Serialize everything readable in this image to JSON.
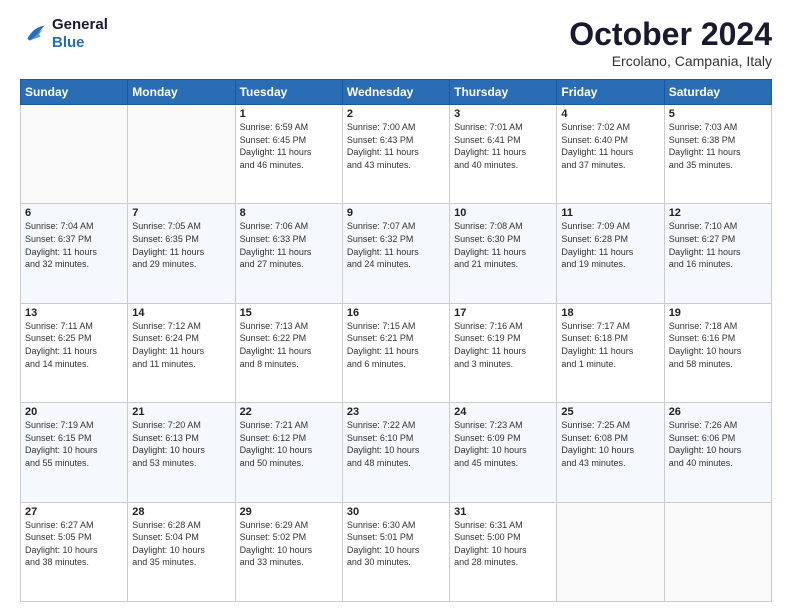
{
  "header": {
    "logo": {
      "line1": "General",
      "line2": "Blue"
    },
    "title": "October 2024",
    "location": "Ercolano, Campania, Italy"
  },
  "weekdays": [
    "Sunday",
    "Monday",
    "Tuesday",
    "Wednesday",
    "Thursday",
    "Friday",
    "Saturday"
  ],
  "weeks": [
    [
      {
        "day": "",
        "info": ""
      },
      {
        "day": "",
        "info": ""
      },
      {
        "day": "1",
        "info": "Sunrise: 6:59 AM\nSunset: 6:45 PM\nDaylight: 11 hours\nand 46 minutes."
      },
      {
        "day": "2",
        "info": "Sunrise: 7:00 AM\nSunset: 6:43 PM\nDaylight: 11 hours\nand 43 minutes."
      },
      {
        "day": "3",
        "info": "Sunrise: 7:01 AM\nSunset: 6:41 PM\nDaylight: 11 hours\nand 40 minutes."
      },
      {
        "day": "4",
        "info": "Sunrise: 7:02 AM\nSunset: 6:40 PM\nDaylight: 11 hours\nand 37 minutes."
      },
      {
        "day": "5",
        "info": "Sunrise: 7:03 AM\nSunset: 6:38 PM\nDaylight: 11 hours\nand 35 minutes."
      }
    ],
    [
      {
        "day": "6",
        "info": "Sunrise: 7:04 AM\nSunset: 6:37 PM\nDaylight: 11 hours\nand 32 minutes."
      },
      {
        "day": "7",
        "info": "Sunrise: 7:05 AM\nSunset: 6:35 PM\nDaylight: 11 hours\nand 29 minutes."
      },
      {
        "day": "8",
        "info": "Sunrise: 7:06 AM\nSunset: 6:33 PM\nDaylight: 11 hours\nand 27 minutes."
      },
      {
        "day": "9",
        "info": "Sunrise: 7:07 AM\nSunset: 6:32 PM\nDaylight: 11 hours\nand 24 minutes."
      },
      {
        "day": "10",
        "info": "Sunrise: 7:08 AM\nSunset: 6:30 PM\nDaylight: 11 hours\nand 21 minutes."
      },
      {
        "day": "11",
        "info": "Sunrise: 7:09 AM\nSunset: 6:28 PM\nDaylight: 11 hours\nand 19 minutes."
      },
      {
        "day": "12",
        "info": "Sunrise: 7:10 AM\nSunset: 6:27 PM\nDaylight: 11 hours\nand 16 minutes."
      }
    ],
    [
      {
        "day": "13",
        "info": "Sunrise: 7:11 AM\nSunset: 6:25 PM\nDaylight: 11 hours\nand 14 minutes."
      },
      {
        "day": "14",
        "info": "Sunrise: 7:12 AM\nSunset: 6:24 PM\nDaylight: 11 hours\nand 11 minutes."
      },
      {
        "day": "15",
        "info": "Sunrise: 7:13 AM\nSunset: 6:22 PM\nDaylight: 11 hours\nand 8 minutes."
      },
      {
        "day": "16",
        "info": "Sunrise: 7:15 AM\nSunset: 6:21 PM\nDaylight: 11 hours\nand 6 minutes."
      },
      {
        "day": "17",
        "info": "Sunrise: 7:16 AM\nSunset: 6:19 PM\nDaylight: 11 hours\nand 3 minutes."
      },
      {
        "day": "18",
        "info": "Sunrise: 7:17 AM\nSunset: 6:18 PM\nDaylight: 11 hours\nand 1 minute."
      },
      {
        "day": "19",
        "info": "Sunrise: 7:18 AM\nSunset: 6:16 PM\nDaylight: 10 hours\nand 58 minutes."
      }
    ],
    [
      {
        "day": "20",
        "info": "Sunrise: 7:19 AM\nSunset: 6:15 PM\nDaylight: 10 hours\nand 55 minutes."
      },
      {
        "day": "21",
        "info": "Sunrise: 7:20 AM\nSunset: 6:13 PM\nDaylight: 10 hours\nand 53 minutes."
      },
      {
        "day": "22",
        "info": "Sunrise: 7:21 AM\nSunset: 6:12 PM\nDaylight: 10 hours\nand 50 minutes."
      },
      {
        "day": "23",
        "info": "Sunrise: 7:22 AM\nSunset: 6:10 PM\nDaylight: 10 hours\nand 48 minutes."
      },
      {
        "day": "24",
        "info": "Sunrise: 7:23 AM\nSunset: 6:09 PM\nDaylight: 10 hours\nand 45 minutes."
      },
      {
        "day": "25",
        "info": "Sunrise: 7:25 AM\nSunset: 6:08 PM\nDaylight: 10 hours\nand 43 minutes."
      },
      {
        "day": "26",
        "info": "Sunrise: 7:26 AM\nSunset: 6:06 PM\nDaylight: 10 hours\nand 40 minutes."
      }
    ],
    [
      {
        "day": "27",
        "info": "Sunrise: 6:27 AM\nSunset: 5:05 PM\nDaylight: 10 hours\nand 38 minutes."
      },
      {
        "day": "28",
        "info": "Sunrise: 6:28 AM\nSunset: 5:04 PM\nDaylight: 10 hours\nand 35 minutes."
      },
      {
        "day": "29",
        "info": "Sunrise: 6:29 AM\nSunset: 5:02 PM\nDaylight: 10 hours\nand 33 minutes."
      },
      {
        "day": "30",
        "info": "Sunrise: 6:30 AM\nSunset: 5:01 PM\nDaylight: 10 hours\nand 30 minutes."
      },
      {
        "day": "31",
        "info": "Sunrise: 6:31 AM\nSunset: 5:00 PM\nDaylight: 10 hours\nand 28 minutes."
      },
      {
        "day": "",
        "info": ""
      },
      {
        "day": "",
        "info": ""
      }
    ]
  ]
}
